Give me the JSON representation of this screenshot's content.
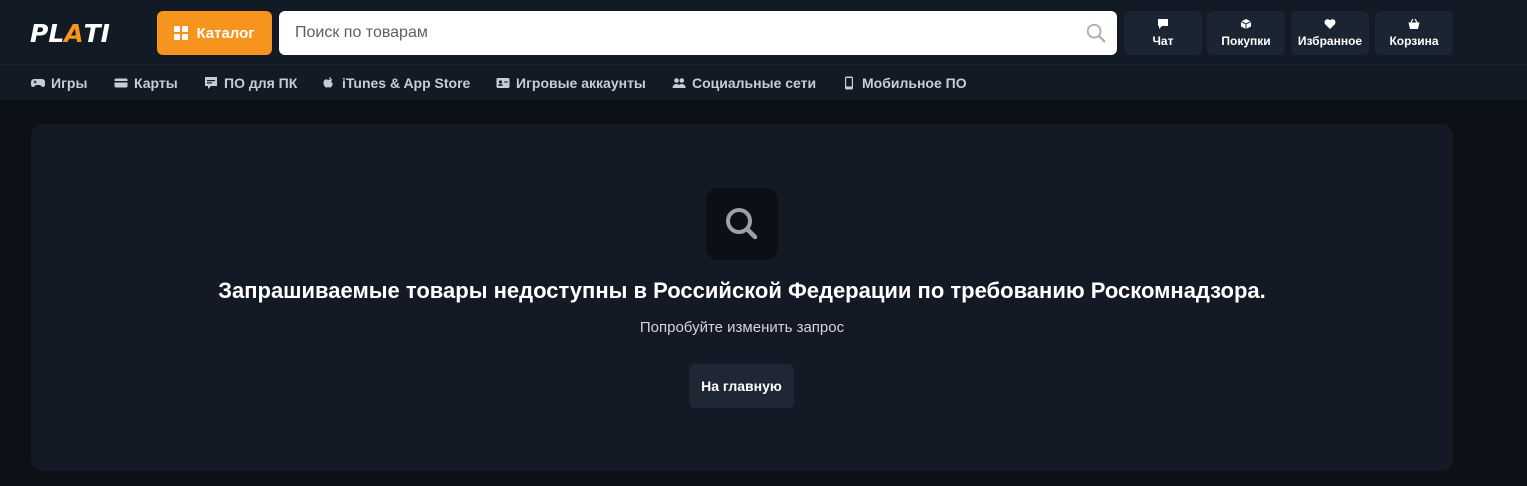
{
  "brand": {
    "logo_text_1": "PL",
    "logo_text_2": "A",
    "logo_text_3": "TI",
    "accent_color": "#f7941d"
  },
  "header": {
    "catalog_label": "Каталог",
    "search_placeholder": "Поиск по товарам",
    "buttons": [
      {
        "label": "Чат",
        "icon": "chat-icon"
      },
      {
        "label": "Покупки",
        "icon": "box-icon"
      },
      {
        "label": "Избранное",
        "icon": "heart-icon"
      },
      {
        "label": "Корзина",
        "icon": "basket-icon"
      }
    ]
  },
  "nav": {
    "items": [
      {
        "label": "Игры",
        "icon": "gamepad-icon"
      },
      {
        "label": "Карты",
        "icon": "card-icon"
      },
      {
        "label": "ПО для ПК",
        "icon": "software-icon"
      },
      {
        "label": "iTunes & App Store",
        "icon": "apple-icon"
      },
      {
        "label": "Игровые аккаунты",
        "icon": "account-icon"
      },
      {
        "label": "Социальные сети",
        "icon": "users-icon"
      },
      {
        "label": "Мобильное ПО",
        "icon": "mobile-icon"
      }
    ]
  },
  "empty_state": {
    "icon": "search-icon",
    "title": "Запрашиваемые товары недоступны в Российской Федерации по требованию Роскомнадзора.",
    "subtitle": "Попробуйте изменить запрос",
    "home_button": "На главную"
  }
}
